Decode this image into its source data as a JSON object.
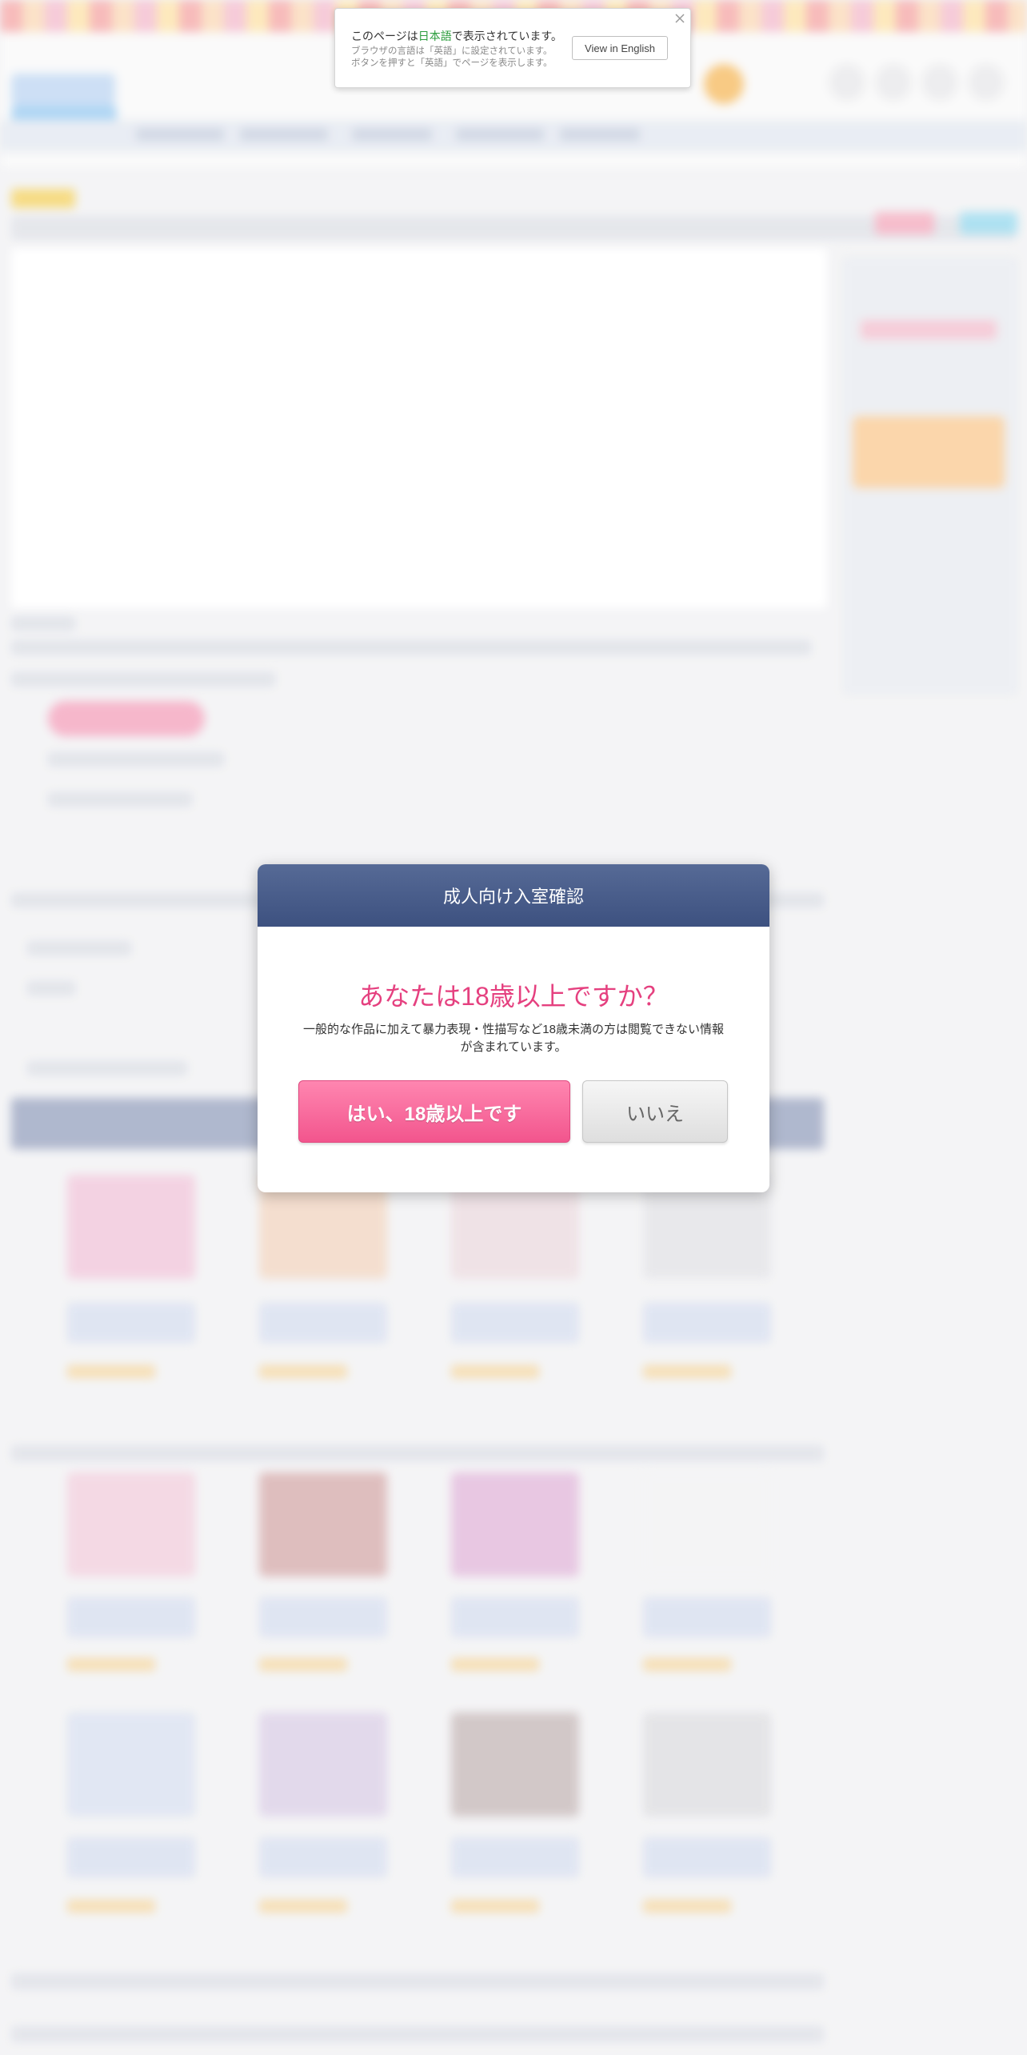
{
  "language_popup": {
    "message_prefix": "このページは",
    "message_language": "日本語",
    "message_suffix": "で表示されています。",
    "sub_line_1": "ブラウザの言語は「英語」に設定されています。",
    "sub_line_2": "ボタンを押すと「英語」でページを表示します。",
    "button_label": "View in English",
    "close_icon": "close-icon"
  },
  "age_modal": {
    "title": "成人向け入室確認",
    "question": "あなたは18歳以上ですか？",
    "description": "一般的な作品に加えて暴力表現・性描写など18歳未満の方は閲覧できない情報が含まれています。",
    "yes_label": "はい、18歳以上です",
    "no_label": "いいえ"
  },
  "colors": {
    "modal_header": "#4a5d8a",
    "question_text": "#e5407f",
    "yes_button": "#f2558d",
    "no_button": "#e8e8e8",
    "language_highlight": "#2a9c3c"
  }
}
